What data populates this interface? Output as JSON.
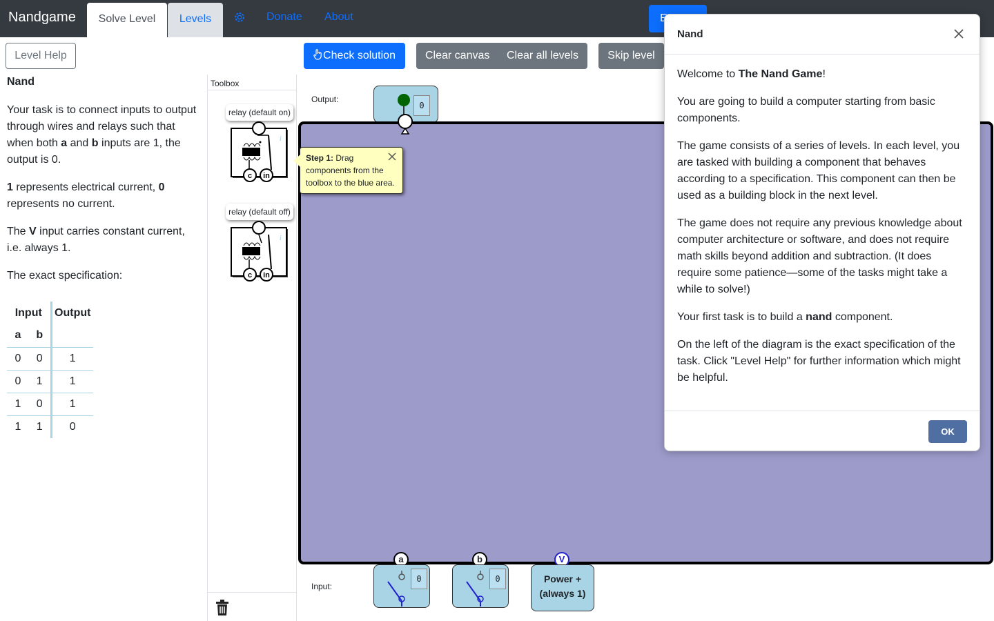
{
  "navbar": {
    "brand": "Nandgame",
    "tabs": [
      {
        "label": "Solve Level",
        "active": true
      },
      {
        "label": "Levels",
        "active": false
      }
    ],
    "settings_icon": "gear-icon",
    "links": [
      "Donate",
      "About"
    ],
    "hidden_button_label": "E"
  },
  "left": {
    "help_button": "Level Help",
    "level_title": "Nand",
    "description": {
      "p1_pre": "Your task is to connect inputs to output through wires and relays such that when both ",
      "p1_a": "a",
      "p1_mid": " and ",
      "p1_b": "b",
      "p1_post": " inputs are 1, the output is 0.",
      "p2_one": "1",
      "p2_mid": " represents electrical current, ",
      "p2_zero": "0",
      "p2_post": " represents no current.",
      "p3_pre": "The ",
      "p3_v": "V",
      "p3_post": " input carries constant current, i.e. always 1.",
      "p4": "The exact specification:"
    },
    "spec_table": {
      "header_input": "Input",
      "header_output": "Output",
      "col_a": "a",
      "col_b": "b",
      "rows": [
        {
          "a": "0",
          "b": "0",
          "out": "1"
        },
        {
          "a": "0",
          "b": "1",
          "out": "1"
        },
        {
          "a": "1",
          "b": "0",
          "out": "1"
        },
        {
          "a": "1",
          "b": "1",
          "out": "0"
        }
      ]
    }
  },
  "toolbar": {
    "check_solution": "Check solution",
    "check_icon": "hand-pointer-icon",
    "clear_canvas": "Clear canvas",
    "clear_all_levels": "Clear all levels",
    "skip_level": "Skip level"
  },
  "toolbox": {
    "header": "Toolbox",
    "components": [
      {
        "label": "relay (default on)",
        "pin_c": "c",
        "pin_in": "in",
        "info": "i"
      },
      {
        "label": "relay (default off)",
        "pin_c": "c",
        "pin_in": "in",
        "info": "i"
      }
    ],
    "trash_icon": "trash-icon"
  },
  "canvas": {
    "output_label": "Output:",
    "output_value": "0",
    "input_label": "Input:",
    "inputs": [
      {
        "pin": "a",
        "value": "0"
      },
      {
        "pin": "b",
        "value": "0"
      }
    ],
    "power": {
      "pin": "V",
      "line1": "Power +",
      "line2": "(always 1)"
    },
    "colors": {
      "canvas": "#9d9bca",
      "node": "#a8d4e6",
      "output_on": "#006400"
    }
  },
  "tooltip": {
    "step": "Step 1:",
    "text": " Drag components from the toolbox to the blue area."
  },
  "modal": {
    "title": "Nand",
    "p1_pre": "Welcome to ",
    "p1_bold": "The Nand Game",
    "p1_post": "!",
    "p2": "You are going to build a computer starting from basic components.",
    "p3": "The game consists of a series of levels. In each level, you are tasked with building a component that behaves according to a specification. This component can then be used as a building block in the next level.",
    "p4": "The game does not require any previous knowledge about computer architecture or software, and does not require math skills beyond addition and subtraction. (It does require some patience—some of the tasks might take a while to solve!)",
    "p5_pre": "Your first task is to build a ",
    "p5_bold": "nand",
    "p5_post": " component.",
    "p6": "On the left of the diagram is the exact specification of the task. Click \"Level Help\" for further information which might be helpful.",
    "ok": "OK"
  }
}
